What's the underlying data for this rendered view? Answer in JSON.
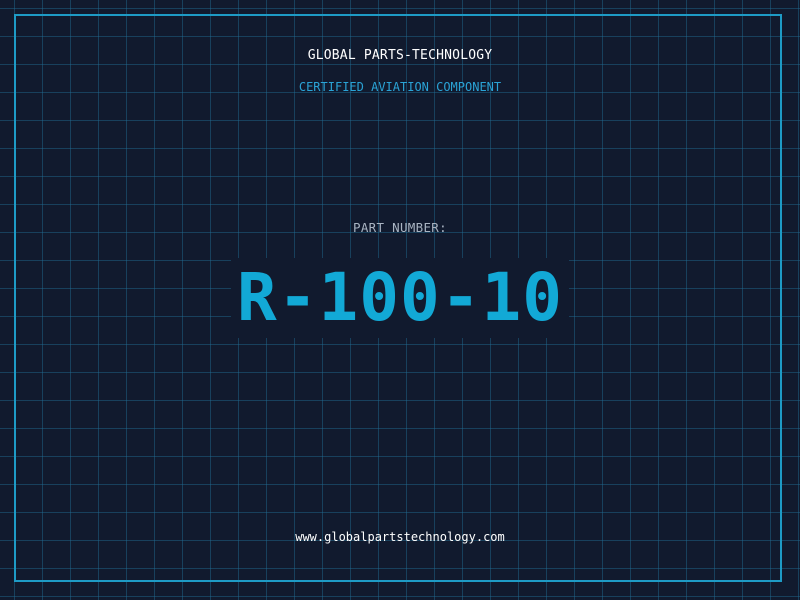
{
  "header": {
    "company": "GLOBAL PARTS-TECHNOLOGY",
    "subtitle": "CERTIFIED AVIATION COMPONENT"
  },
  "part": {
    "label": "PART NUMBER:",
    "number": "R-100-10"
  },
  "footer": {
    "url": "www.globalpartstechnology.com"
  },
  "colors": {
    "background": "#111a2e",
    "grid": "#226e96",
    "accent": "#12a9d6",
    "frame": "#1e9bc6"
  }
}
